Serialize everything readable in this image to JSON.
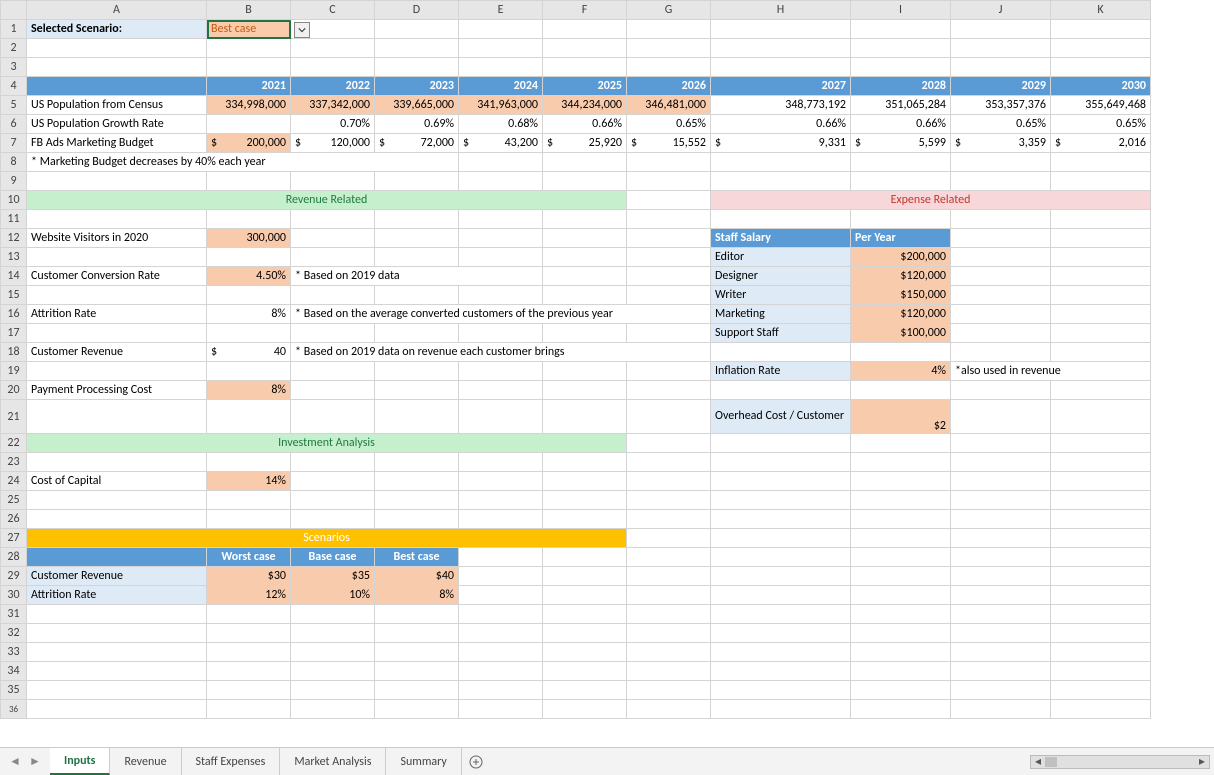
{
  "selected_scenario_label": "Selected Scenario:",
  "selected_scenario_value": "Best case",
  "years": [
    "2021",
    "2022",
    "2023",
    "2024",
    "2025",
    "2026",
    "2027",
    "2028",
    "2029",
    "2030"
  ],
  "row5_label": "US Population from Census",
  "row5": [
    "334,998,000",
    "337,342,000",
    "339,665,000",
    "341,963,000",
    "344,234,000",
    "346,481,000",
    "348,773,192",
    "351,065,284",
    "353,357,376",
    "355,649,468"
  ],
  "row6_label": "US Population Growth Rate",
  "row6": [
    "",
    "0.70%",
    "0.69%",
    "0.68%",
    "0.66%",
    "0.65%",
    "0.66%",
    "0.66%",
    "0.65%",
    "0.65%"
  ],
  "row7_label": "FB Ads Marketing Budget",
  "row7_vals": [
    "200,000",
    "120,000",
    "72,000",
    "43,200",
    "25,920",
    "15,552",
    "9,331",
    "5,599",
    "3,359",
    "2,016"
  ],
  "row8_note": "* Marketing Budget decreases by 40% each year",
  "rev_section": "Revenue Related",
  "exp_section": "Expense Related",
  "inv_section": "Investment Analysis",
  "scen_section": "Scenarios",
  "row12_label": "Website Visitors in 2020",
  "row12_val": "300,000",
  "row14_label": "Customer Conversion Rate",
  "row14_val": "4.50%",
  "row14_note": "* Based on 2019 data",
  "row16_label": "Attrition Rate",
  "row16_val": "8%",
  "row16_note": "* Based on the average converted customers of the previous year",
  "row18_label": "Customer Revenue",
  "row18_cur": "$",
  "row18_val": "40",
  "row18_note": "* Based on 2019 data on revenue each customer brings",
  "row20_label": "Payment Processing Cost",
  "row20_val": "8%",
  "row24_label": "Cost of Capital",
  "row24_val": "14%",
  "staff_hdr1": "Staff Salary",
  "staff_hdr2": "Per Year",
  "staff": [
    {
      "role": "Editor",
      "salary": "$200,000"
    },
    {
      "role": "Designer",
      "salary": "$120,000"
    },
    {
      "role": "Writer",
      "salary": "$150,000"
    },
    {
      "role": "Marketing",
      "salary": "$120,000"
    },
    {
      "role": "Support Staff",
      "salary": "$100,000"
    }
  ],
  "inflation_label": "Inflation Rate",
  "inflation_val": "4%",
  "inflation_note": "*also used in revenue",
  "overhead_label": "Overhead Cost / Customer",
  "overhead_val": "$2",
  "scen_cols": [
    "Worst case",
    "Base case",
    "Best case"
  ],
  "scen_row29_label": "Customer Revenue",
  "scen_row29": [
    "$30",
    "$35",
    "$40"
  ],
  "scen_row30_label": "Attrition Rate",
  "scen_row30": [
    "12%",
    "10%",
    "8%"
  ],
  "tabs": [
    "Inputs",
    "Revenue",
    "Staff Expenses",
    "Market Analysis",
    "Summary"
  ],
  "active_tab": "Inputs",
  "col_letters": [
    "A",
    "B",
    "C",
    "D",
    "E",
    "F",
    "G",
    "H",
    "I",
    "J",
    "K"
  ]
}
